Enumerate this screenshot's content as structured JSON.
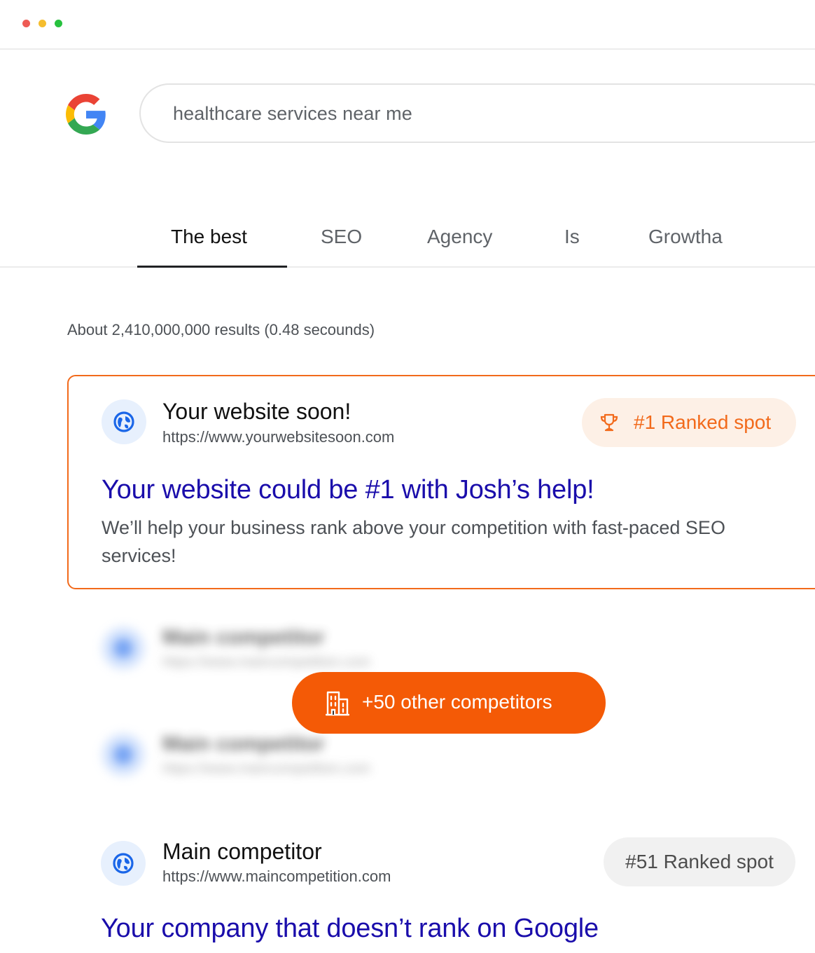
{
  "window": {
    "controls": [
      "close",
      "minimize",
      "zoom"
    ]
  },
  "search": {
    "query": "healthcare services near me",
    "logo_icon": "google-g-icon"
  },
  "tabs": [
    {
      "label": "The best",
      "active": true
    },
    {
      "label": "SEO"
    },
    {
      "label": "Agency"
    },
    {
      "label": "Is"
    },
    {
      "label": "Growtha"
    }
  ],
  "results_count": "About 2,410,000,000 results (0.48 secounds)",
  "featured_result": {
    "site_name": "Your website soon!",
    "url": "https://www.yourwebsitesoon.com",
    "badge": "#1 Ranked spot",
    "badge_icon": "trophy-icon",
    "headline": "Your website could be #1 with Josh’s help!",
    "snippet_line1": "We’ll help your business rank above your competition with fast-paced SEO",
    "snippet_line2": "services!"
  },
  "blurred_results": [
    {
      "site_name": "Main competitor",
      "url": "https://www.maincompetition.com"
    },
    {
      "site_name": "Main competitor",
      "url": "https://www.maincompetition.com"
    }
  ],
  "competitors_button": {
    "label": "+50 other competitors",
    "icon": "building-icon"
  },
  "bottom_result": {
    "site_name": "Main competitor",
    "url": "https://www.maincompetition.com",
    "badge": "#51 Ranked spot",
    "headline": "Your company that doesn’t rank on Google"
  },
  "colors": {
    "accent": "#f45a06",
    "link": "#1a0dab",
    "card_border": "#f26a1b"
  }
}
